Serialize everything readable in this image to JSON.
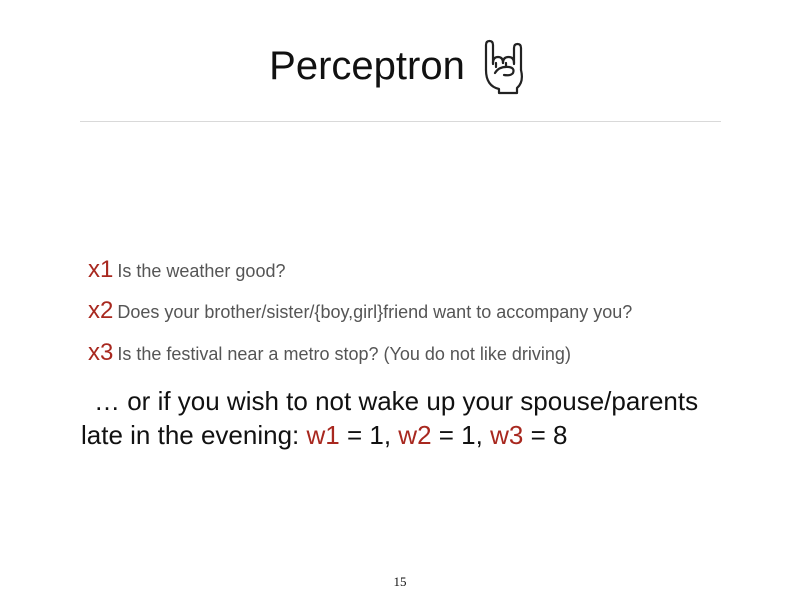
{
  "slide": {
    "title": "Perceptron",
    "title_icon": "rock-on-hand-icon",
    "questions": [
      {
        "label": "x1",
        "text": "Is the weather good?"
      },
      {
        "label": "x2",
        "text": "Does your brother/sister/{boy,girl}friend want to accompany you?"
      },
      {
        "label": "x3",
        "text": "Is the festival near a metro stop? (You do not like driving)"
      }
    ],
    "statement": {
      "line1": "… or if you wish to not wake up your spouse/parents",
      "line2_prefix": "late in the evening: ",
      "w1_label": "w1",
      "w1_value": " = 1, ",
      "w2_label": "w2",
      "w2_value": " = 1, ",
      "w3_label": "w3",
      "w3_value": " = 8"
    },
    "page_number": "15"
  },
  "colors": {
    "accent_red": "#a8281f",
    "body_gray": "#555555",
    "text_dark": "#111111",
    "divider": "#d9d9d9"
  }
}
